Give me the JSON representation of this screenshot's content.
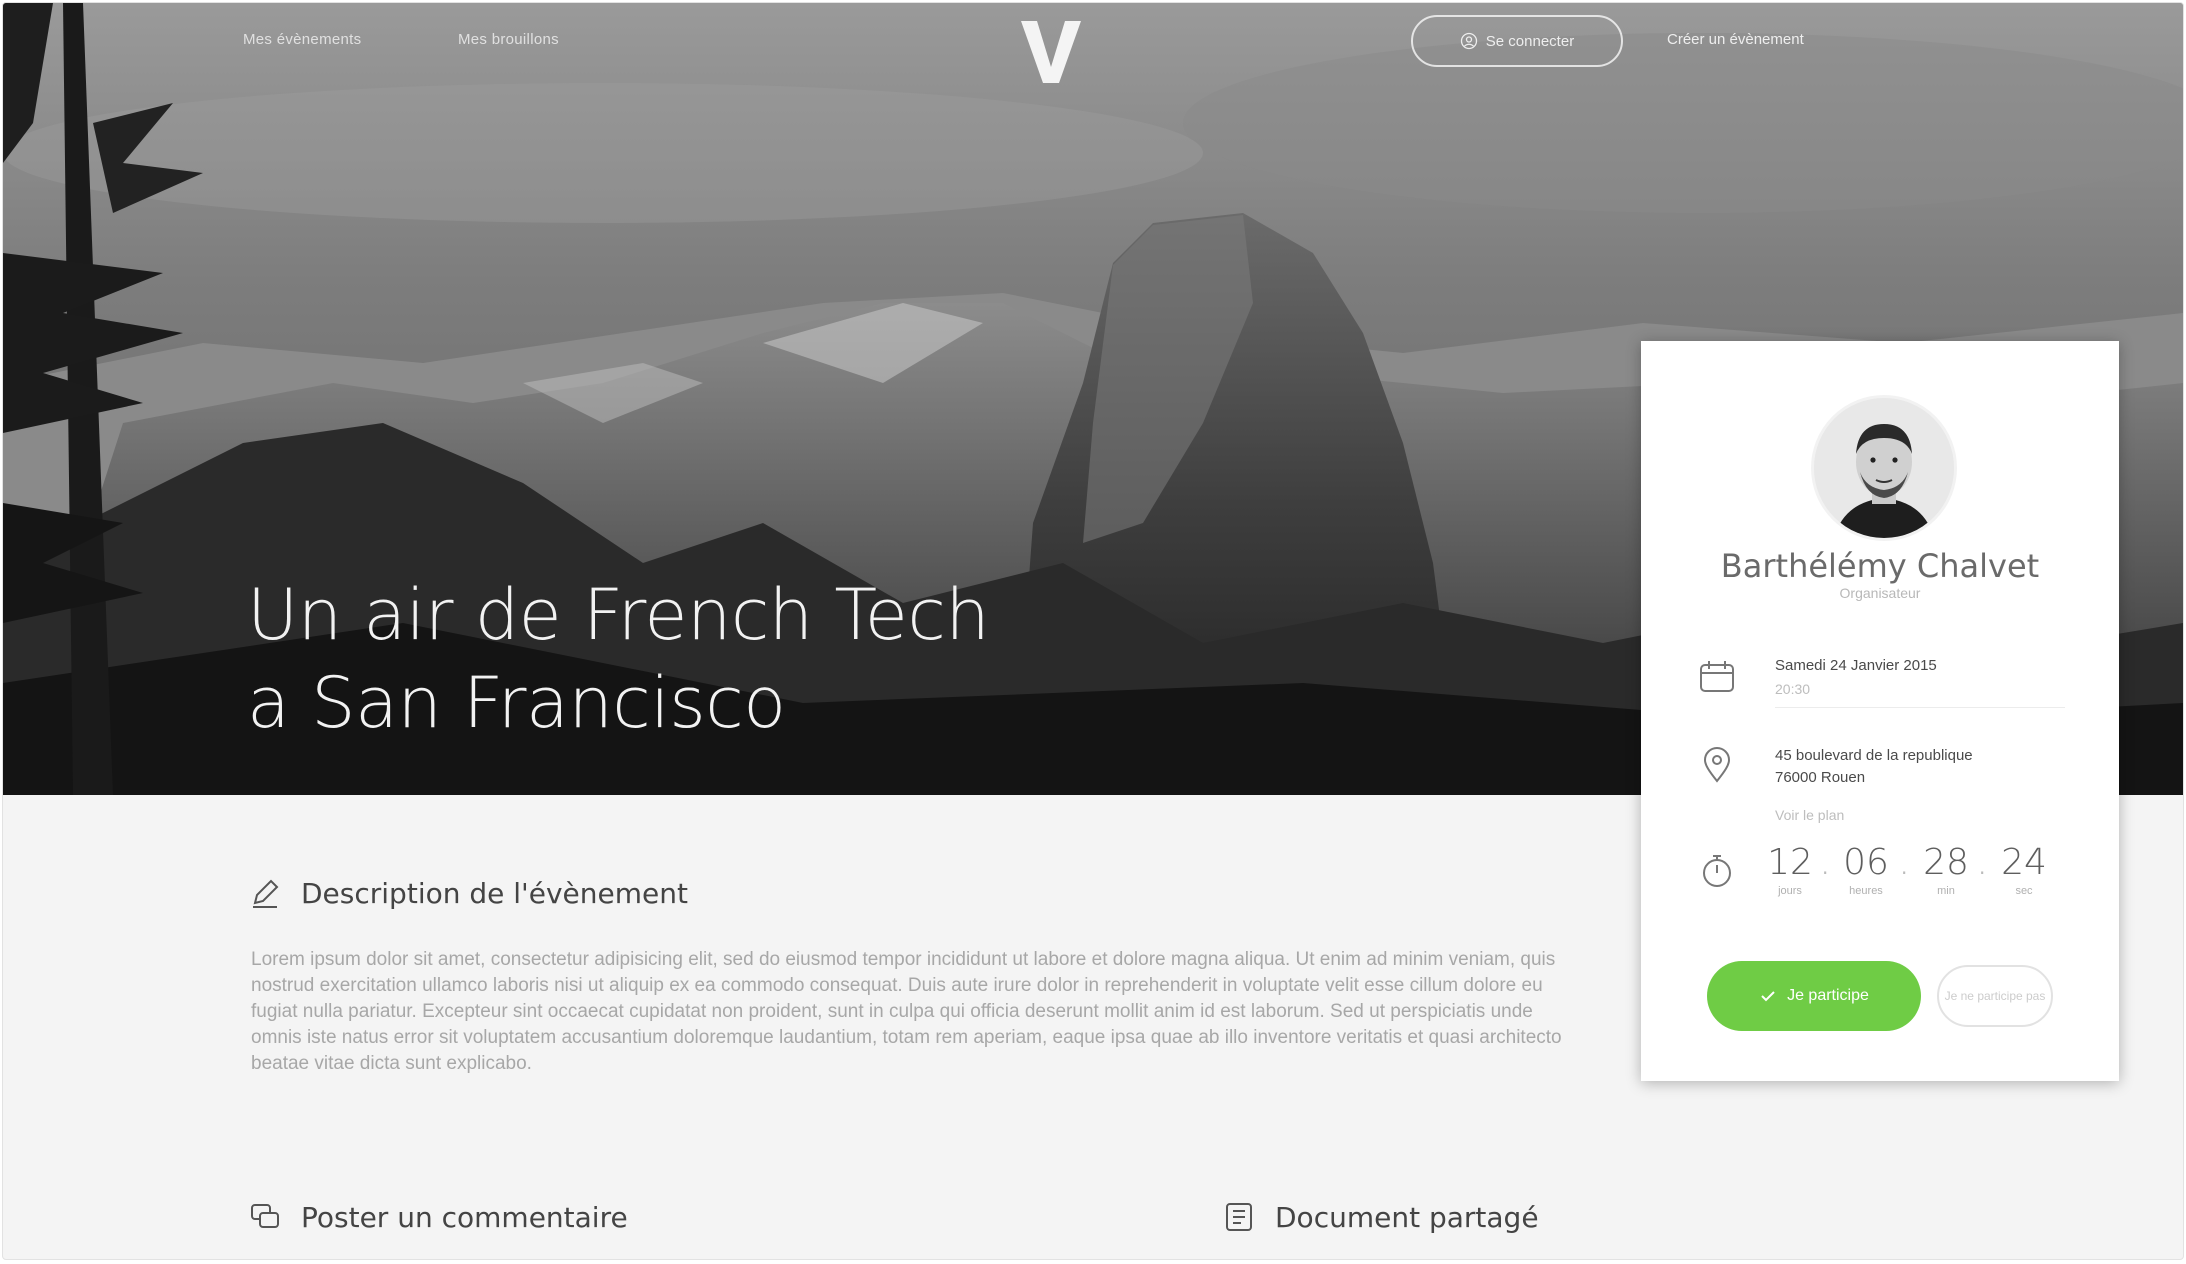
{
  "nav": {
    "links": [
      "Mes évènements",
      "Mes brouillons"
    ],
    "logo_text": "V",
    "login_label": "Se connecter",
    "create_event_label": "Créer un évènement"
  },
  "event": {
    "title_line1": "Un air de French Tech",
    "title_line2": "a San Francisco"
  },
  "description": {
    "heading": "Description de l'évènement",
    "body": "Lorem ipsum dolor sit amet, consectetur adipisicing elit, sed do eiusmod tempor incididunt ut labore et dolore magna aliqua. Ut enim ad minim veniam, quis nostrud exercitation ullamco laboris nisi ut aliquip ex ea commodo consequat. Duis aute irure dolor in reprehenderit in voluptate velit esse cillum dolore eu fugiat nulla pariatur. Excepteur sint occaecat cupidatat non proident, sunt in culpa qui officia deserunt mollit anim id est laborum. Sed ut perspiciatis unde omnis iste natus error sit voluptatem accusantium doloremque laudantium, totam rem aperiam, eaque ipsa quae ab illo inventore veritatis et quasi architecto beatae vitae dicta sunt explicabo."
  },
  "bottom": {
    "comment_heading": "Poster un commentaire",
    "document_heading": "Document partagé"
  },
  "organizer": {
    "name": "Barthélémy Chalvet",
    "role": "Organisateur",
    "date": "Samedi 24 Janvier 2015",
    "time": "20:30",
    "address_line1": "45 boulevard de la republique",
    "address_line2": "76000 Rouen",
    "map_link": "Voir le plan",
    "countdown": {
      "days": "12",
      "days_label": "jours",
      "hours": "06",
      "hours_label": "heures",
      "minutes": "28",
      "minutes_label": "min",
      "seconds": "24",
      "seconds_label": "sec"
    },
    "participate_label": "Je participe",
    "decline_label": "Je ne participe pas"
  },
  "colors": {
    "accent_green": "#6fcc45",
    "page_bg": "#f4f4f4",
    "card_bg": "#ffffff"
  },
  "icons": {
    "description": "pencil-icon",
    "comment": "comment-icon",
    "document": "document-icon",
    "date": "calendar-icon",
    "location": "location-pin-icon",
    "countdown": "stopwatch-icon",
    "login": "user-icon",
    "participate": "check-icon"
  }
}
